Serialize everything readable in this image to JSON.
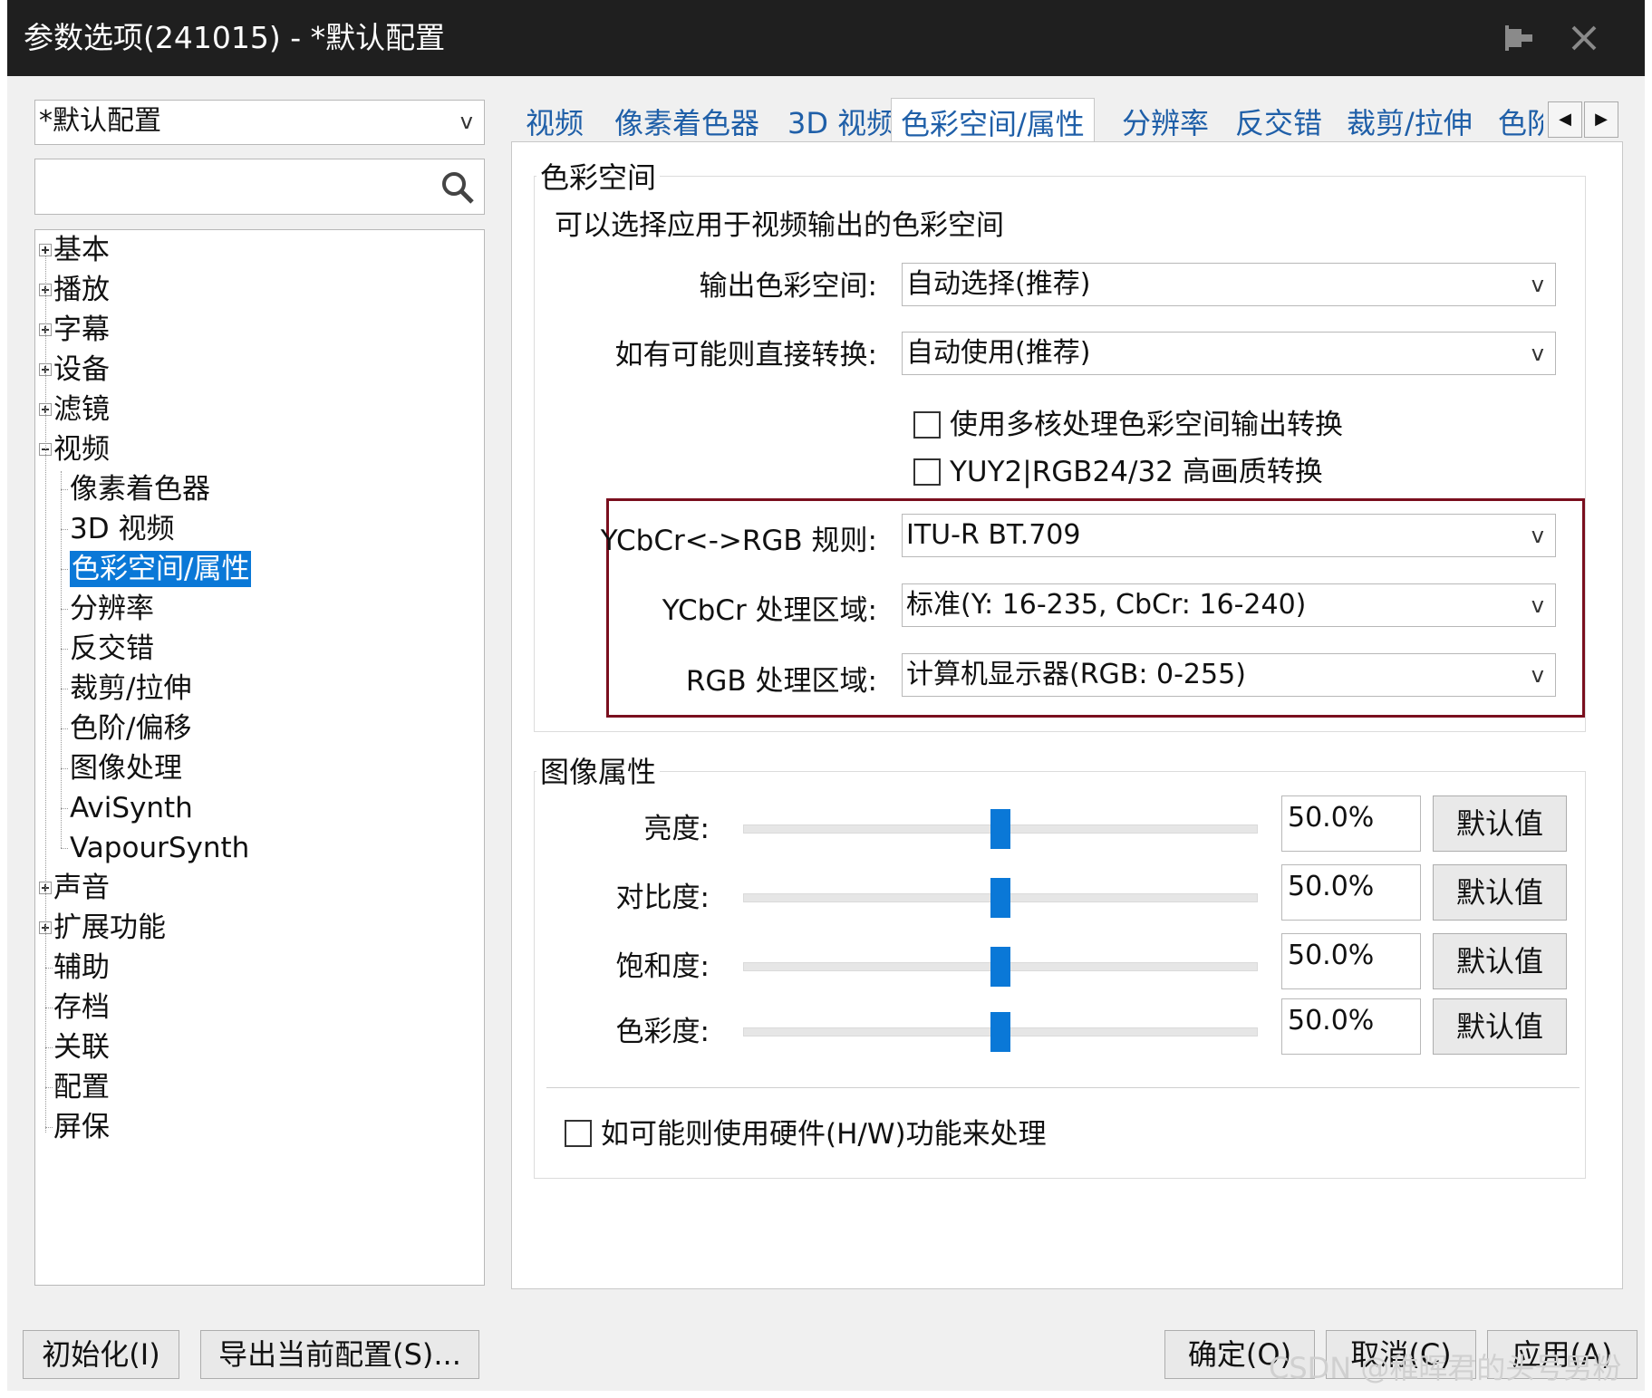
{
  "window": {
    "title": "参数选项(241015) - *默认配置",
    "pin_icon": "pin-icon",
    "close_icon": "close-icon"
  },
  "sidebar": {
    "profile_value": "*默认配置",
    "search_placeholder": "",
    "tree": [
      {
        "label": "基本",
        "expander": "plus"
      },
      {
        "label": "播放",
        "expander": "plus"
      },
      {
        "label": "字幕",
        "expander": "plus"
      },
      {
        "label": "设备",
        "expander": "plus"
      },
      {
        "label": "滤镜",
        "expander": "plus"
      },
      {
        "label": "视频",
        "expander": "minus"
      },
      {
        "label": "像素着色器",
        "child": true
      },
      {
        "label": "3D 视频",
        "child": true
      },
      {
        "label": "色彩空间/属性",
        "child": true,
        "selected": true
      },
      {
        "label": "分辨率",
        "child": true
      },
      {
        "label": "反交错",
        "child": true
      },
      {
        "label": "裁剪/拉伸",
        "child": true
      },
      {
        "label": "色阶/偏移",
        "child": true
      },
      {
        "label": "图像处理",
        "child": true
      },
      {
        "label": "AviSynth",
        "child": true
      },
      {
        "label": "VapourSynth",
        "child": true
      },
      {
        "label": "声音",
        "expander": "plus"
      },
      {
        "label": "扩展功能",
        "expander": "plus"
      },
      {
        "label": "辅助"
      },
      {
        "label": "存档"
      },
      {
        "label": "关联"
      },
      {
        "label": "配置"
      },
      {
        "label": "屏保"
      }
    ]
  },
  "tabs": [
    {
      "label": "视频"
    },
    {
      "label": "像素着色器"
    },
    {
      "label": "3D 视频"
    },
    {
      "label": "色彩空间/属性",
      "active": true
    },
    {
      "label": "分辨率"
    },
    {
      "label": "反交错"
    },
    {
      "label": "裁剪/拉伸"
    },
    {
      "label": "色阶"
    }
  ],
  "tab_scroll": {
    "left": "◀",
    "right": "▶"
  },
  "color_space": {
    "group_title": "色彩空间",
    "description": "可以选择应用于视频输出的色彩空间",
    "output_label": "输出色彩空间:",
    "output_value": "自动选择(推荐)",
    "direct_label": "如有可能则直接转换:",
    "direct_value": "自动使用(推荐)",
    "multicore_label": "使用多核处理色彩空间输出转换",
    "yuy2_label": "YUY2|RGB24/32 高画质转换",
    "rule_label": "YCbCr<->RGB 规则:",
    "rule_value": "ITU-R BT.709",
    "ycbcr_range_label": "YCbCr 处理区域:",
    "ycbcr_range_value": "标准(Y: 16-235, CbCr: 16-240)",
    "rgb_range_label": "RGB 处理区域:",
    "rgb_range_value": "计算机显示器(RGB: 0-255)",
    "dropdown_arrow": "v"
  },
  "image_props": {
    "group_title": "图像属性",
    "rows": [
      {
        "label": "亮度:",
        "value": "50.0%",
        "level": 0.5,
        "button": "默认值"
      },
      {
        "label": "对比度:",
        "value": "50.0%",
        "level": 0.5,
        "button": "默认值"
      },
      {
        "label": "饱和度:",
        "value": "50.0%",
        "level": 0.5,
        "button": "默认值"
      },
      {
        "label": "色彩度:",
        "value": "50.0%",
        "level": 0.5,
        "button": "默认值"
      }
    ],
    "hw_label": "如可能则使用硬件(H/W)功能来处理"
  },
  "footer": {
    "init_button": "初始化(I)",
    "export_button": "导出当前配置(S)...",
    "ok_button": "确定(O)",
    "cancel_button": "取消(C)",
    "apply_button": "应用(A)"
  },
  "watermark": "CSDN @稚晖君的头号男粉",
  "colors": {
    "accent": "#0a78d7",
    "titlebar": "#1f1f1f",
    "tab_text": "#1f5fa8",
    "highlight_border": "#7a0f1e"
  }
}
